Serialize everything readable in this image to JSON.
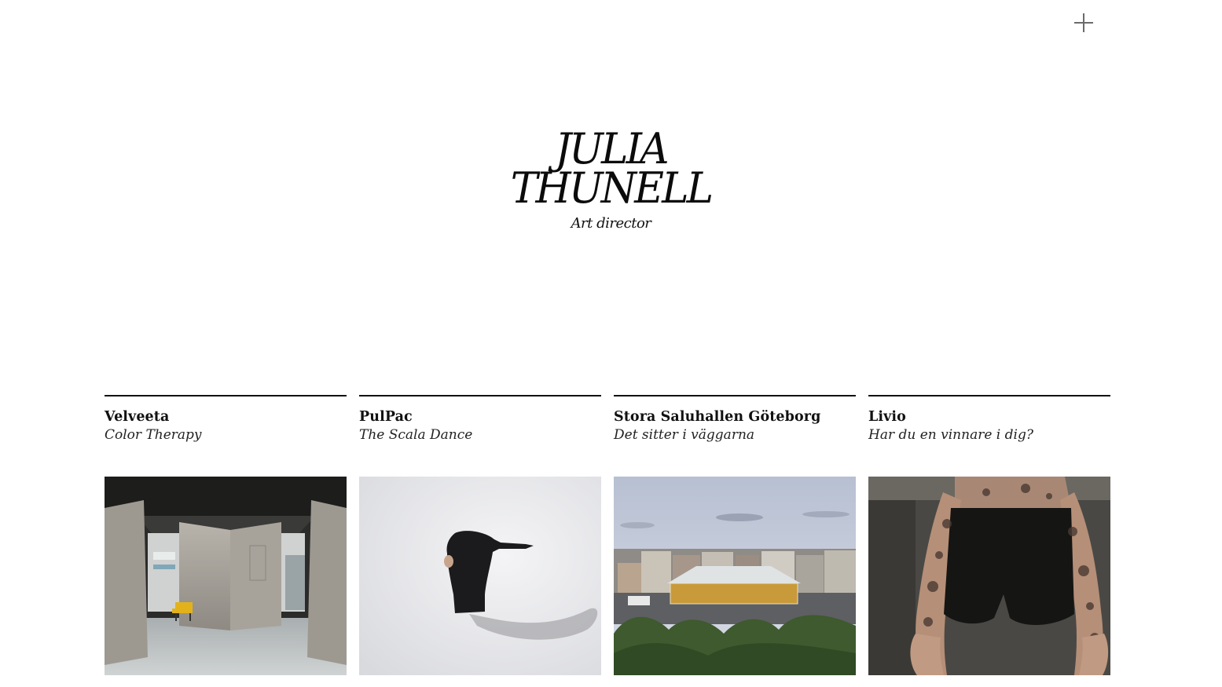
{
  "header": {
    "menu_icon": "plus-icon"
  },
  "logo": {
    "line1": "JULIA",
    "line2": "THUNELL",
    "tagline": "Art director"
  },
  "projects": [
    {
      "client": "Velveeta",
      "title": "Color Therapy",
      "image": "subway-station-photo"
    },
    {
      "client": "PulPac",
      "title": "The Scala Dance",
      "image": "dancer-photo"
    },
    {
      "client": "Stora Saluhallen Göteborg",
      "title": "Det sitter i väggarna",
      "image": "market-hall-photo"
    },
    {
      "client": "Livio",
      "title": "Har du en vinnare i dig?",
      "image": "tattooed-man-photo"
    }
  ],
  "colors": {
    "text": "#111111",
    "background": "#ffffff",
    "menu_icon": "#6b6b6b"
  }
}
